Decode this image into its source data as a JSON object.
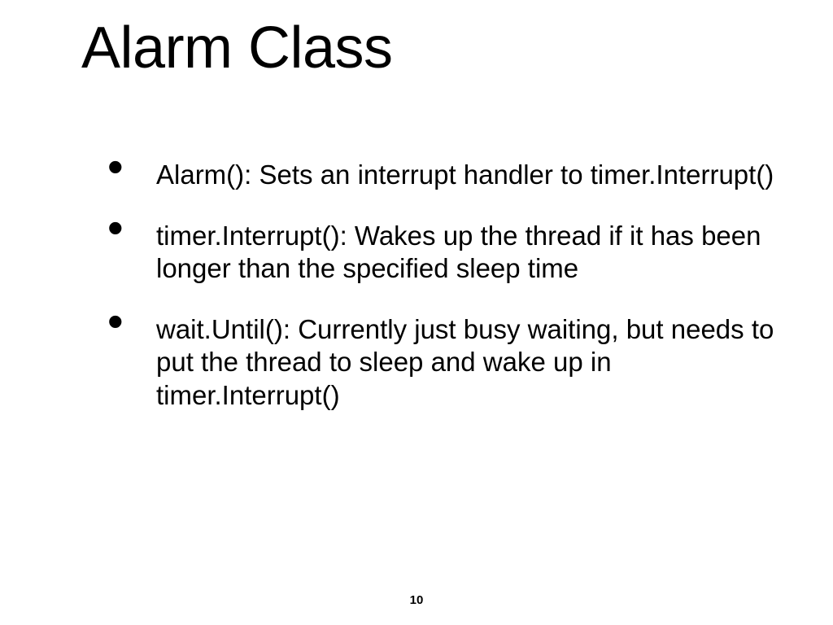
{
  "slide": {
    "title": "Alarm Class",
    "bullets": [
      {
        "lead": "Alarm()",
        "rest": ": Sets an interrupt handler to timer.Interrupt()"
      },
      {
        "lead": "timer.Interrupt()",
        "rest": ": Wakes up the thread if it has been longer than the specified sleep time"
      },
      {
        "lead": "wait.Until()",
        "rest": ": Currently just busy waiting, but needs to put the thread to sleep and wake up in timer.Interrupt()"
      }
    ],
    "page_number": "10"
  }
}
